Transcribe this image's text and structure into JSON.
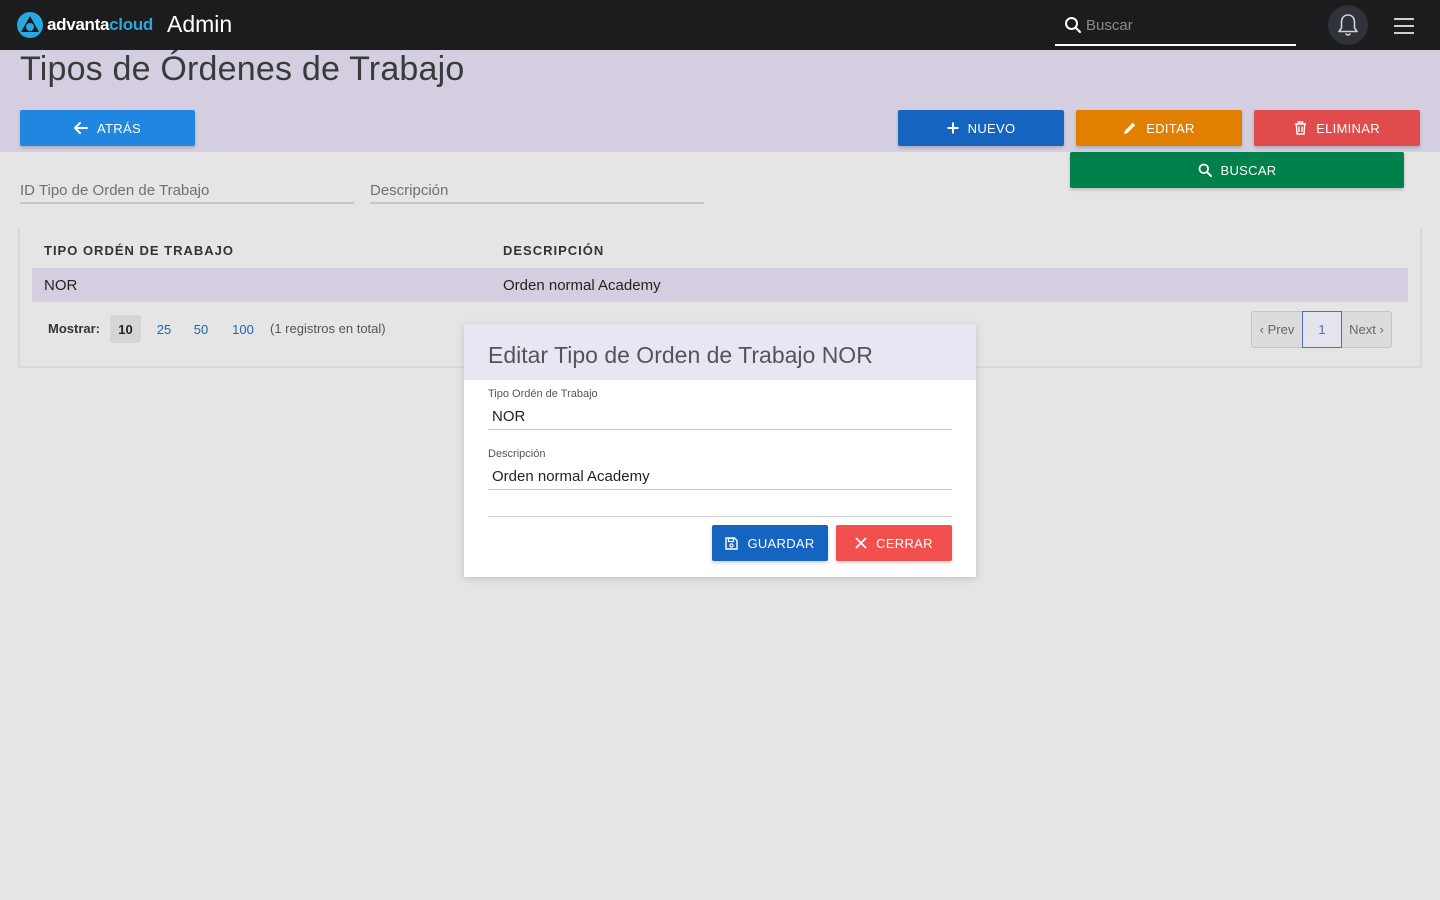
{
  "topbar": {
    "logo_part1": "advanta",
    "logo_part2": "cloud",
    "title": "Admin",
    "search_placeholder": "Buscar",
    "icons": [
      "search-icon",
      "bell-icon",
      "hamburger-menu-icon"
    ]
  },
  "page": {
    "title": "Tipos de Órdenes de Trabajo"
  },
  "toolbar": {
    "back_label": "ATRÁS",
    "new_label": "NUEVO",
    "edit_label": "EDITAR",
    "delete_label": "ELIMINAR",
    "search_label": "BUSCAR"
  },
  "filters": {
    "id_placeholder": "ID Tipo de Orden de Trabajo",
    "description_placeholder": "Descripción"
  },
  "table": {
    "columns": [
      "TIPO ORDÉN DE TRABAJO",
      "DESCRIPCIÓN"
    ],
    "rows": [
      [
        "NOR",
        "Orden normal Academy"
      ]
    ]
  },
  "pagination": {
    "show_label": "Mostrar:",
    "page_sizes": [
      "10",
      "25",
      "50",
      "100"
    ],
    "selected_page_size": "10",
    "total_text": "(1 registros en total)",
    "prev_label": "‹ Prev",
    "current_page": "1",
    "next_label": "Next ›"
  },
  "modal": {
    "title": "Editar Tipo de Orden de Trabajo NOR",
    "field1_label": "Tipo Ordén de Trabajo",
    "field1_value": "NOR",
    "field2_label": "Descripción",
    "field2_value": "Orden normal Academy",
    "save_label": "GUARDAR",
    "close_label": "CERRAR"
  },
  "colors": {
    "topbar": "#1c1c1e",
    "header_band": "#d4cee0",
    "back": "#1f87e0",
    "new": "#1565c0",
    "edit": "#e07f00",
    "delete": "#e24b4b",
    "search": "#00804a",
    "close": "#f2504f"
  }
}
